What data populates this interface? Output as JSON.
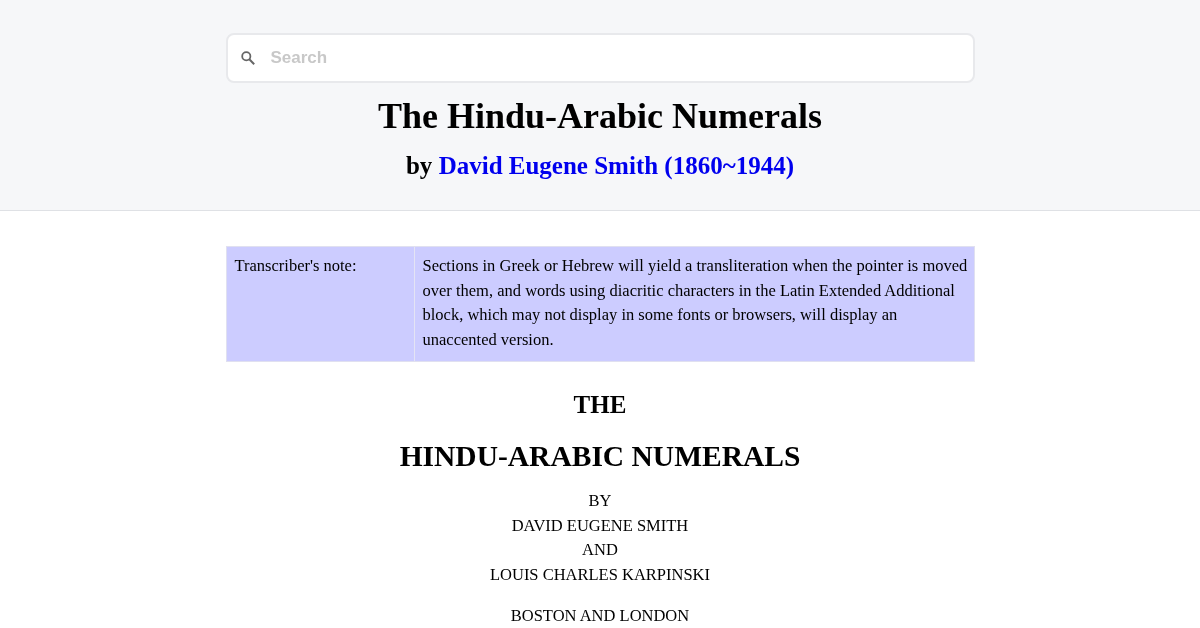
{
  "search": {
    "placeholder": "Search"
  },
  "header": {
    "title": "The Hindu-Arabic Numerals",
    "byline": {
      "prefix": "by",
      "author_link": "David Eugene Smith (1860~1944)"
    }
  },
  "transcribers_note": {
    "label": "Transcriber's note:",
    "text": "Sections in Greek or Hebrew will yield a transliteration when the pointer is moved over them, and words using diacritic characters in the Latin Extended Additional block, which may not display in some fonts or browsers, will display an unaccented version."
  },
  "title_page": {
    "heading": "THE",
    "title": "HINDU-ARABIC NUMERALS",
    "authors": [
      "BY",
      "DAVID EUGENE SMITH",
      "AND",
      "LOUIS CHARLES KARPINSKI"
    ],
    "imprint": "BOSTON AND LONDON"
  }
}
